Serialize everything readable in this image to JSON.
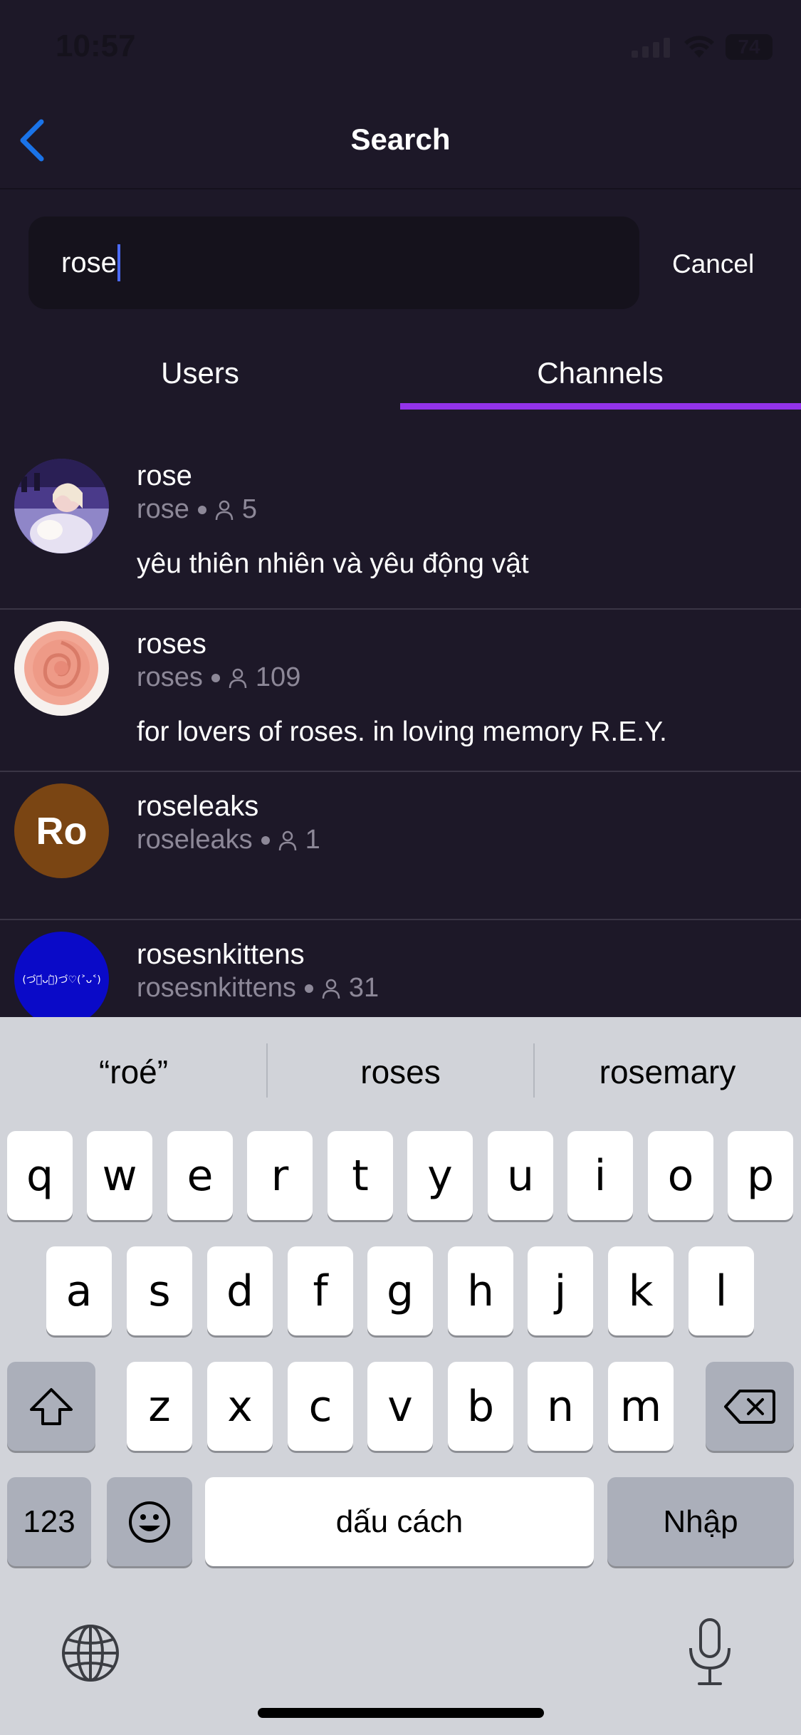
{
  "status_bar": {
    "time": "10:57",
    "battery": "74"
  },
  "nav": {
    "title": "Search"
  },
  "search": {
    "value": "rose",
    "cancel_label": "Cancel"
  },
  "tabs": [
    {
      "label": "Users",
      "selected": false
    },
    {
      "label": "Channels",
      "selected": true
    }
  ],
  "colors": {
    "accent": "#9333ea",
    "background": "#1d1828",
    "back_arrow": "#1a73e8"
  },
  "channels": [
    {
      "name": "rose",
      "handle": "rose",
      "members": "5",
      "description": "yêu thiên nhiên và yêu động vật",
      "avatar": "photo"
    },
    {
      "name": "roses",
      "handle": "roses",
      "members": "109",
      "description": "for lovers of roses. in loving memory R.E.Y.",
      "avatar": "rose-photo"
    },
    {
      "name": "roseleaks",
      "handle": "roseleaks",
      "members": "1",
      "description": "",
      "avatar_text": "Ro"
    },
    {
      "name": "rosesnkittens",
      "handle": "rosesnkittens",
      "members": "31",
      "description": "",
      "avatar_text": "(づ･᷄ᴗ･᷅)づ♡(˃ᴗ˂)"
    }
  ],
  "keyboard": {
    "suggestions": [
      "“roé”",
      "roses",
      "rosemary"
    ],
    "row1": [
      "q",
      "w",
      "e",
      "r",
      "t",
      "y",
      "u",
      "i",
      "o",
      "p"
    ],
    "row2": [
      "a",
      "s",
      "d",
      "f",
      "g",
      "h",
      "j",
      "k",
      "l"
    ],
    "row3": [
      "z",
      "x",
      "c",
      "v",
      "b",
      "n",
      "m"
    ],
    "numbers_label": "123",
    "space_label": "dấu cách",
    "return_label": "Nhập"
  }
}
